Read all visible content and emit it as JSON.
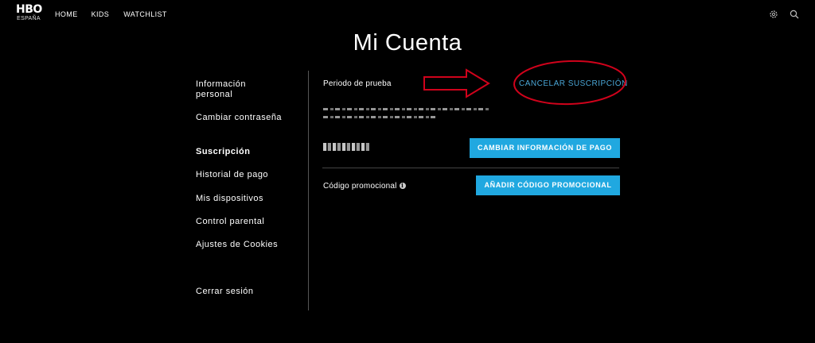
{
  "logo": {
    "mark": "HBO",
    "sub": "ESPAÑA"
  },
  "nav": {
    "items": [
      "HOME",
      "KIDS",
      "WATCHLIST"
    ]
  },
  "top_icons": [
    "gear-icon",
    "search-icon"
  ],
  "page": {
    "title": "Mi Cuenta"
  },
  "sidebar": {
    "items": [
      {
        "label": "Información personal",
        "active": false
      },
      {
        "label": "Cambiar contraseña",
        "active": false
      },
      {
        "label": "Suscripción",
        "active": true
      },
      {
        "label": "Historial de pago",
        "active": false
      },
      {
        "label": "Mis dispositivos",
        "active": false
      },
      {
        "label": "Control parental",
        "active": false
      },
      {
        "label": "Ajustes de Cookies",
        "active": false
      },
      {
        "label": "Cerrar sesión",
        "active": false
      }
    ]
  },
  "subscription": {
    "plan_label": "Periodo de prueba",
    "cancel_label": "CANCELAR SUSCRIPCIÓN",
    "change_payment_button": "CAMBIAR INFORMACIÓN DE PAGO",
    "promo_label": "Código promocional",
    "promo_info_glyph": "i",
    "add_promo_button": "AÑADIR CÓDIGO PROMOCIONAL"
  },
  "colors": {
    "accent": "#20a8e0",
    "link": "#4aa6d6",
    "annotation": "#d0021b",
    "background": "#000000"
  }
}
